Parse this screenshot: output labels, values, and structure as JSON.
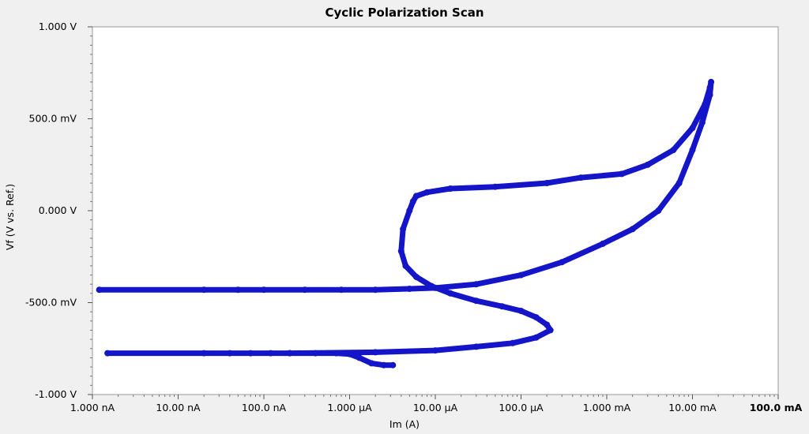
{
  "chart_data": {
    "type": "scatter",
    "title": "Cyclic Polarization Scan",
    "xlabel": "Im (A)",
    "ylabel": "Vf (V vs. Ref.)",
    "x_scale": "log",
    "xlim": [
      1e-09,
      0.1
    ],
    "ylim": [
      -1.0,
      1.0
    ],
    "x_ticks": [
      {
        "value": 1e-09,
        "label": "1.000 nA"
      },
      {
        "value": 1e-08,
        "label": "10.00 nA"
      },
      {
        "value": 1e-07,
        "label": "100.0 nA"
      },
      {
        "value": 1e-06,
        "label": "1.000 µA"
      },
      {
        "value": 1e-05,
        "label": "10.00 µA"
      },
      {
        "value": 0.0001,
        "label": "100.0 µA"
      },
      {
        "value": 0.001,
        "label": "1.000 mA"
      },
      {
        "value": 0.01,
        "label": "10.00 mA"
      },
      {
        "value": 0.1,
        "label": "100.0 mA"
      }
    ],
    "y_ticks": [
      {
        "value": 1.0,
        "label": "1.000 V"
      },
      {
        "value": 0.5,
        "label": "500.0 mV"
      },
      {
        "value": 0.0,
        "label": "0.000 V"
      },
      {
        "value": -0.5,
        "label": "-500.0 mV"
      },
      {
        "value": -1.0,
        "label": "-1.000 V"
      }
    ],
    "grid": false,
    "legend": "none",
    "series_color": "#1414c8",
    "series": [
      {
        "x": [
          3.2e-06,
          2.5e-06,
          1.8e-06,
          1.3e-06,
          1e-06,
          7e-07,
          4e-07,
          2e-07,
          1.2e-07,
          7e-08,
          4e-08,
          2e-08,
          1.5e-09,
          2e-07,
          2e-06,
          1e-05,
          3e-05,
          8e-05,
          0.00015,
          0.00022,
          0.0002,
          0.00015,
          0.0001,
          6e-05,
          3e-05,
          1.5e-05,
          9e-06,
          6e-06,
          4.5e-06,
          4e-06,
          4.2e-06,
          5e-06,
          5.5e-06,
          6e-06,
          8e-06,
          1.5e-05,
          5e-05,
          0.0002,
          0.0005,
          0.0015,
          0.003,
          0.006,
          0.01,
          0.014,
          0.016,
          0.0165,
          0.016,
          0.013,
          0.01,
          0.007,
          0.004,
          0.002,
          0.0009,
          0.0003,
          0.0001,
          3e-05,
          1e-05,
          5e-06,
          2e-06,
          8e-07,
          3e-07,
          1e-07,
          5e-08,
          2e-08,
          1.2e-09
        ],
        "y": [
          -0.84,
          -0.84,
          -0.83,
          -0.8,
          -0.78,
          -0.775,
          -0.775,
          -0.775,
          -0.775,
          -0.775,
          -0.775,
          -0.775,
          -0.775,
          -0.775,
          -0.77,
          -0.76,
          -0.74,
          -0.72,
          -0.69,
          -0.65,
          -0.62,
          -0.58,
          -0.545,
          -0.52,
          -0.49,
          -0.45,
          -0.41,
          -0.36,
          -0.3,
          -0.22,
          -0.1,
          0.0,
          0.05,
          0.08,
          0.1,
          0.12,
          0.13,
          0.15,
          0.18,
          0.2,
          0.25,
          0.33,
          0.45,
          0.58,
          0.67,
          0.7,
          0.63,
          0.48,
          0.33,
          0.15,
          0.0,
          -0.1,
          -0.18,
          -0.28,
          -0.35,
          -0.4,
          -0.42,
          -0.425,
          -0.43,
          -0.43,
          -0.43,
          -0.43,
          -0.43,
          -0.43,
          -0.43
        ]
      }
    ]
  }
}
